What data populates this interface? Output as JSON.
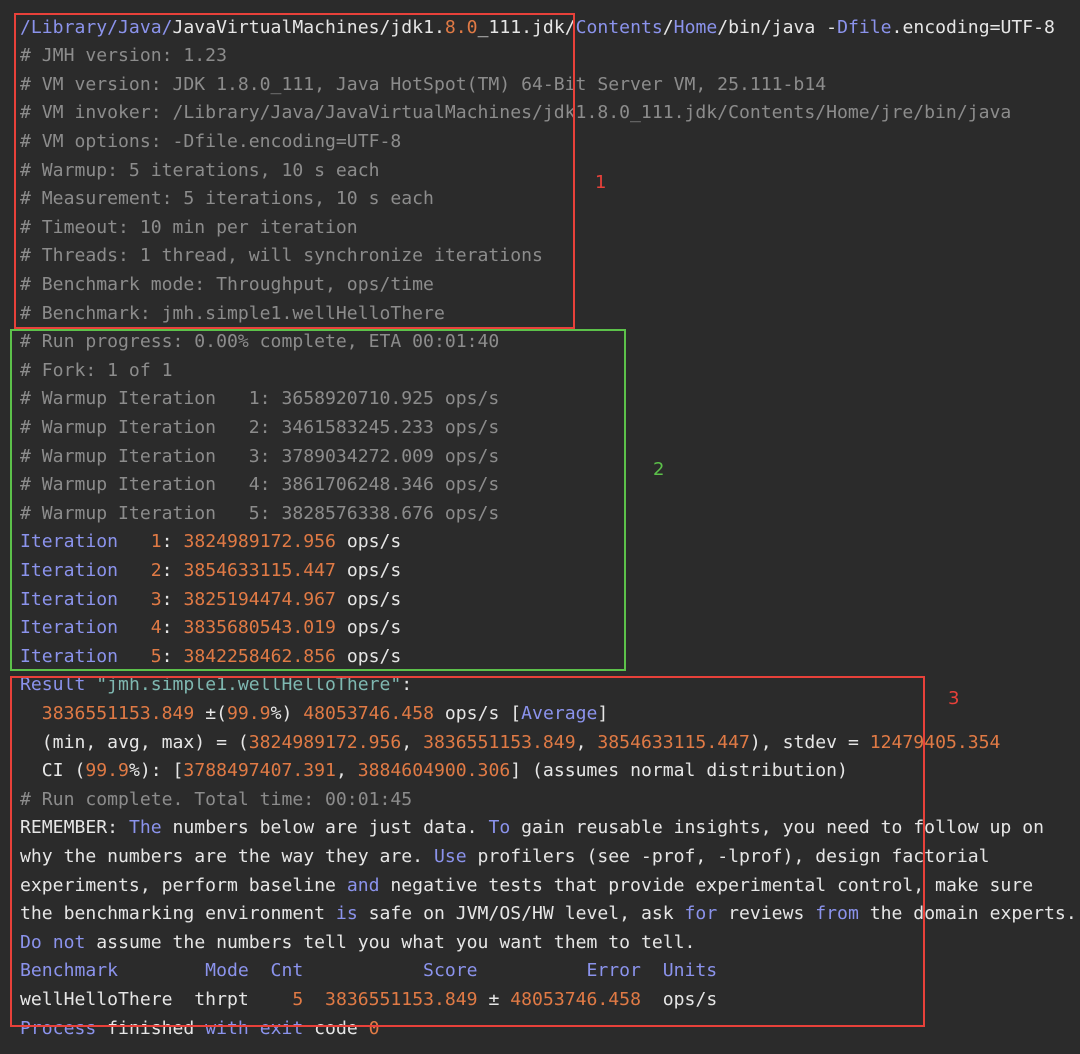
{
  "colors": {
    "comment": "#8c8c8c",
    "text": "#e6e6e6",
    "keyword": "#8b93ec",
    "number": "#e07a45",
    "string": "#7fb8b1",
    "box_red": "#e8413a",
    "box_green": "#5cc14a"
  },
  "markers": [
    "1",
    "2",
    "3"
  ],
  "lines": [
    [
      [
        "k",
        "/Library/Java/"
      ],
      [
        "w",
        "JavaVirtualMachines"
      ],
      [
        "w",
        "/jdk1."
      ],
      [
        "n",
        "8.0"
      ],
      [
        "w",
        "_111.jdk/"
      ],
      [
        "k",
        "Contents"
      ],
      [
        "w",
        "/"
      ],
      [
        "k",
        "Home"
      ],
      [
        "w",
        "/bin/java -"
      ],
      [
        "k",
        "Dfile"
      ],
      [
        "w",
        ".encoding=UTF-8"
      ]
    ],
    [
      [
        "c",
        "# JMH version: 1.23"
      ]
    ],
    [
      [
        "c",
        "# VM version: JDK 1.8.0_111, Java HotSpot(TM) 64-Bit Server VM, 25.111-b14"
      ]
    ],
    [
      [
        "c",
        "# VM invoker: /Library/Java/JavaVirtualMachines/jdk1.8.0_111.jdk/Contents/Home/jre/bin/java"
      ]
    ],
    [
      [
        "c",
        "# VM options: -Dfile.encoding=UTF-8"
      ]
    ],
    [
      [
        "c",
        "# Warmup: 5 iterations, 10 s each"
      ]
    ],
    [
      [
        "c",
        "# Measurement: 5 iterations, 10 s each"
      ]
    ],
    [
      [
        "c",
        "# Timeout: 10 min per iteration"
      ]
    ],
    [
      [
        "c",
        "# Threads: 1 thread, will synchronize iterations"
      ]
    ],
    [
      [
        "c",
        "# Benchmark mode: Throughput, ops/time"
      ]
    ],
    [
      [
        "c",
        "# Benchmark: jmh.simple1.wellHelloThere"
      ]
    ],
    [
      [
        "c",
        "# Run progress: 0.00% complete, ETA 00:01:40"
      ]
    ],
    [
      [
        "c",
        "# Fork: 1 of 1"
      ]
    ],
    [
      [
        "c",
        "# Warmup Iteration   1: 3658920710.925 ops/s"
      ]
    ],
    [
      [
        "c",
        "# Warmup Iteration   2: 3461583245.233 ops/s"
      ]
    ],
    [
      [
        "c",
        "# Warmup Iteration   3: 3789034272.009 ops/s"
      ]
    ],
    [
      [
        "c",
        "# Warmup Iteration   4: 3861706248.346 ops/s"
      ]
    ],
    [
      [
        "c",
        "# Warmup Iteration   5: 3828576338.676 ops/s"
      ]
    ],
    [
      [
        "k",
        "Iteration   "
      ],
      [
        "n",
        "1"
      ],
      [
        "w",
        ": "
      ],
      [
        "n",
        "3824989172.956"
      ],
      [
        "w",
        " ops/s"
      ]
    ],
    [
      [
        "k",
        "Iteration   "
      ],
      [
        "n",
        "2"
      ],
      [
        "w",
        ": "
      ],
      [
        "n",
        "3854633115.447"
      ],
      [
        "w",
        " ops/s"
      ]
    ],
    [
      [
        "k",
        "Iteration   "
      ],
      [
        "n",
        "3"
      ],
      [
        "w",
        ": "
      ],
      [
        "n",
        "3825194474.967"
      ],
      [
        "w",
        " ops/s"
      ]
    ],
    [
      [
        "k",
        "Iteration   "
      ],
      [
        "n",
        "4"
      ],
      [
        "w",
        ": "
      ],
      [
        "n",
        "3835680543.019"
      ],
      [
        "w",
        " ops/s"
      ]
    ],
    [
      [
        "k",
        "Iteration   "
      ],
      [
        "n",
        "5"
      ],
      [
        "w",
        ": "
      ],
      [
        "n",
        "3842258462.856"
      ],
      [
        "w",
        " ops/s"
      ]
    ],
    [
      [
        "k",
        "Result "
      ],
      [
        "s",
        "\"jmh.simple1.wellHelloThere\""
      ],
      [
        "w",
        ":"
      ]
    ],
    [
      [
        "w",
        "  "
      ],
      [
        "n",
        "3836551153.849"
      ],
      [
        "w",
        " ±("
      ],
      [
        "n",
        "99.9"
      ],
      [
        "w",
        "%) "
      ],
      [
        "n",
        "48053746.458"
      ],
      [
        "w",
        " ops/s ["
      ],
      [
        "k",
        "Average"
      ],
      [
        "w",
        "]"
      ]
    ],
    [
      [
        "w",
        "  (min, avg, max) = ("
      ],
      [
        "n",
        "3824989172.956"
      ],
      [
        "w",
        ", "
      ],
      [
        "n",
        "3836551153.849"
      ],
      [
        "w",
        ", "
      ],
      [
        "n",
        "3854633115.447"
      ],
      [
        "w",
        "), stdev = "
      ],
      [
        "n",
        "12479405.354"
      ]
    ],
    [
      [
        "w",
        "  CI ("
      ],
      [
        "n",
        "99.9"
      ],
      [
        "w",
        "%): ["
      ],
      [
        "n",
        "3788497407.391"
      ],
      [
        "w",
        ", "
      ],
      [
        "n",
        "3884604900.306"
      ],
      [
        "w",
        "] (assumes normal distribution)"
      ]
    ],
    [
      [
        "c",
        "# Run complete. Total time: 00:01:45"
      ]
    ],
    [
      [
        "w",
        "REMEMBER: "
      ],
      [
        "k",
        "The"
      ],
      [
        "w",
        " numbers below are just data. "
      ],
      [
        "k",
        "To"
      ],
      [
        "w",
        " gain reusable insights, you need to follow up on"
      ]
    ],
    [
      [
        "w",
        "why the numbers are the way they are. "
      ],
      [
        "k",
        "Use"
      ],
      [
        "w",
        " profilers (see -prof, -lprof), design factorial"
      ]
    ],
    [
      [
        "w",
        "experiments, perform baseline "
      ],
      [
        "k",
        "and"
      ],
      [
        "w",
        " negative tests that provide experimental control, make sure"
      ]
    ],
    [
      [
        "w",
        "the benchmarking environment "
      ],
      [
        "k",
        "is"
      ],
      [
        "w",
        " safe on JVM/OS/HW level, ask "
      ],
      [
        "k",
        "for"
      ],
      [
        "w",
        " reviews "
      ],
      [
        "k",
        "from"
      ],
      [
        "w",
        " the domain experts."
      ]
    ],
    [
      [
        "k",
        "Do"
      ],
      [
        "w",
        " "
      ],
      [
        "k",
        "not"
      ],
      [
        "w",
        " assume the numbers tell you what you want them to tell."
      ]
    ],
    [
      [
        "k",
        "Benchmark        Mode  Cnt           Score          Error  Units"
      ]
    ],
    [
      [
        "w",
        "wellHelloThere  thrpt    "
      ],
      [
        "n",
        "5"
      ],
      [
        "w",
        "  "
      ],
      [
        "n",
        "3836551153.849"
      ],
      [
        "w",
        " ± "
      ],
      [
        "n",
        "48053746.458"
      ],
      [
        "w",
        "  ops/s"
      ]
    ],
    [
      [
        "k",
        "Process"
      ],
      [
        "w",
        " finished "
      ],
      [
        "k",
        "with"
      ],
      [
        "w",
        " "
      ],
      [
        "k",
        "exit"
      ],
      [
        "w",
        " code "
      ],
      [
        "n",
        "0"
      ]
    ]
  ]
}
